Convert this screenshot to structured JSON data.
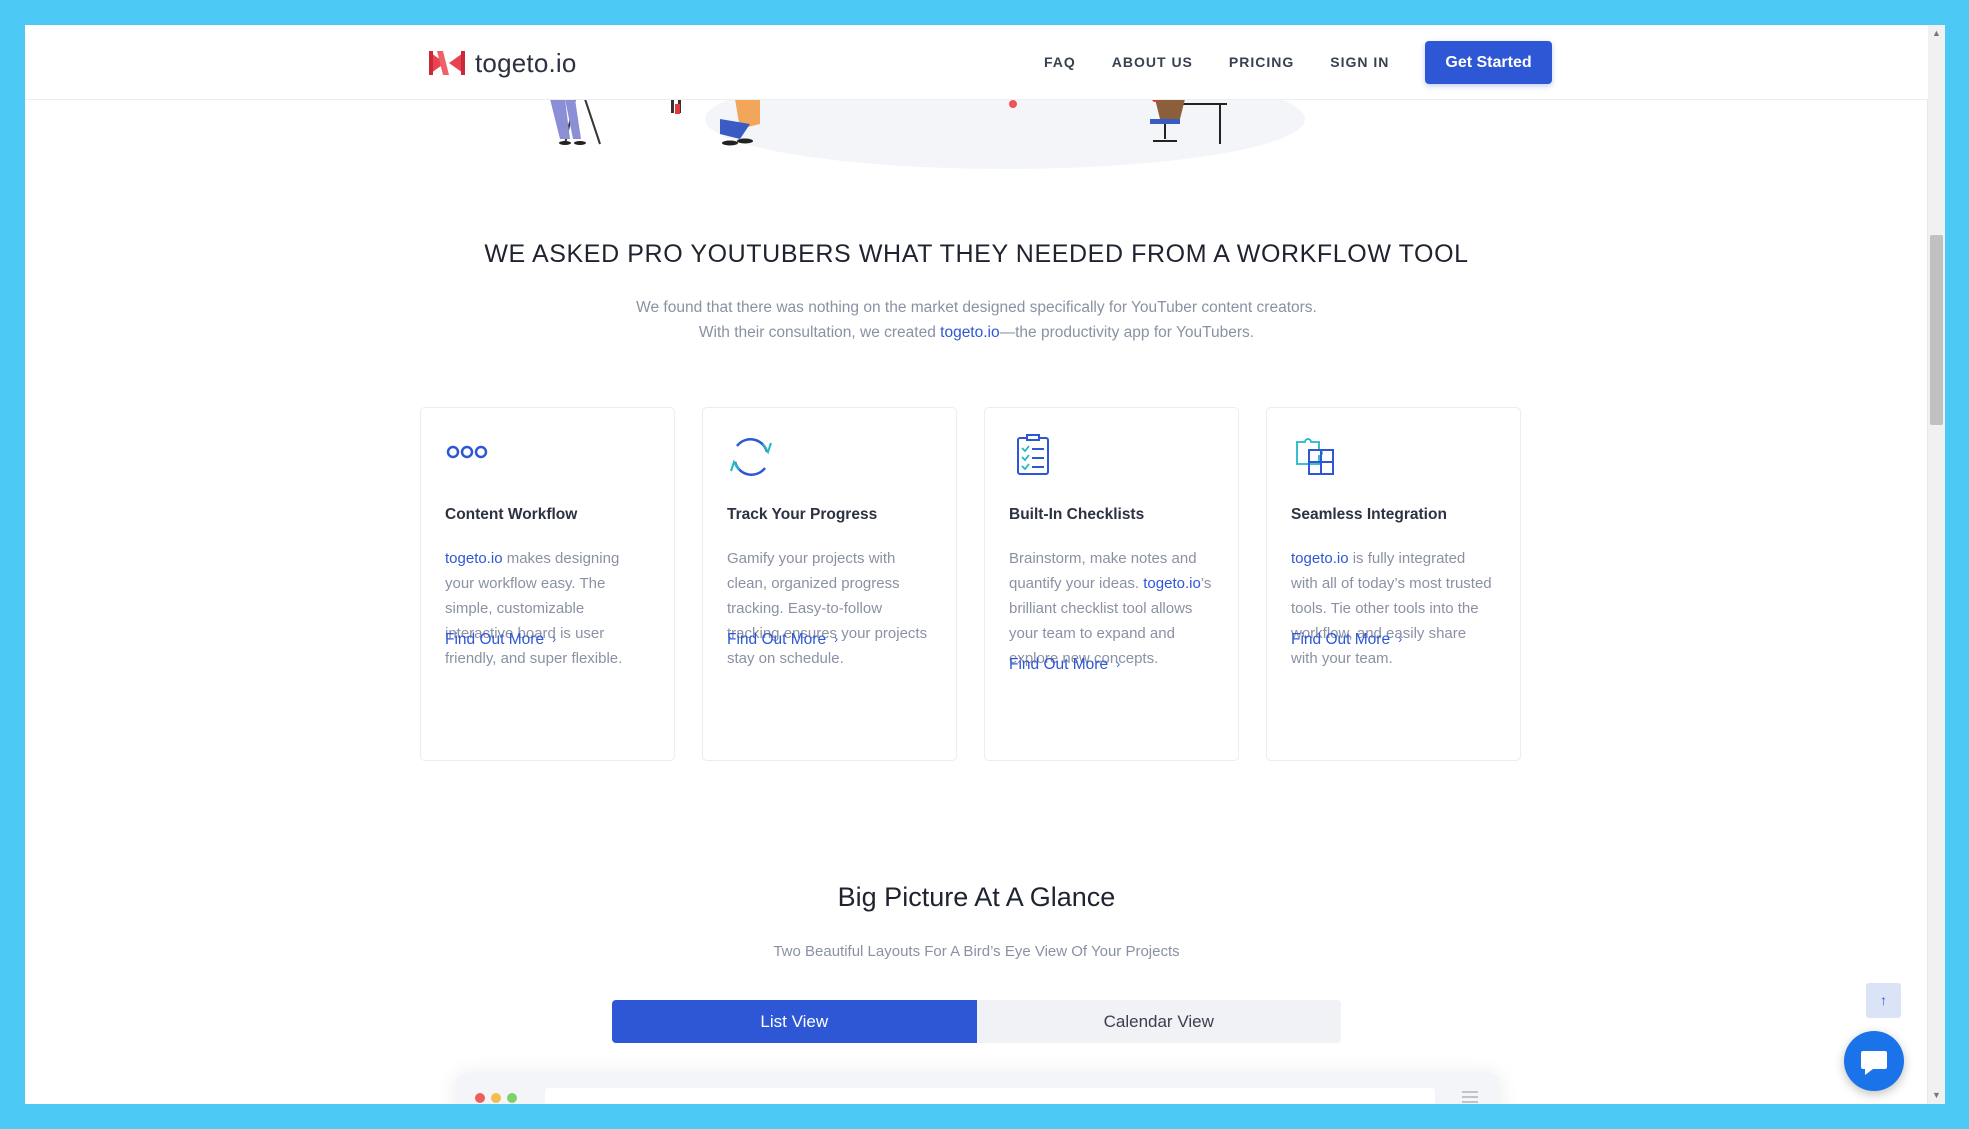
{
  "header": {
    "logo_text": "togeto.io",
    "nav": [
      "FAQ",
      "ABOUT US",
      "PRICING",
      "SIGN IN"
    ],
    "cta": "Get Started"
  },
  "section_features": {
    "title": "WE ASKED PRO YOUTUBERS WHAT THEY NEEDED FROM A WORKFLOW TOOL",
    "intro_line1": "We found that there was nothing on the market designed specifically for YouTuber content creators.",
    "intro_line2_pre": "With their consultation, we created ",
    "intro_line2_brand": "togeto.io",
    "intro_line2_post": "—the productivity app for YouTubers.",
    "cards": [
      {
        "icon": "dots-icon",
        "title": "Content Workflow",
        "brand": "togeto.io",
        "text": " makes designing your workflow easy. The simple, customizable interactive board is user friendly, and super flexible.",
        "link": "Find Out More"
      },
      {
        "icon": "refresh-icon",
        "title": "Track Your Progress",
        "text": "Gamify your projects with clean, organized progress tracking. Easy-to-follow tracking ensures your projects stay on schedule.",
        "link": "Find Out More"
      },
      {
        "icon": "checklist-icon",
        "title": "Built-In Checklists",
        "text_pre": "Brainstorm, make notes and quantify your ideas. ",
        "brand": "togeto.io",
        "text": "’s brilliant checklist tool allows your team to expand and explore new concepts.",
        "link": "Find Out More"
      },
      {
        "icon": "puzzle-icon",
        "title": "Seamless Integration",
        "brand": "togeto.io",
        "text": " is fully integrated with all of today’s most trusted tools. Tie other tools into the workflow, and easily share with your team.",
        "link": "Find Out More"
      }
    ]
  },
  "section_views": {
    "title": "Big Picture At A Glance",
    "subtitle": "Two Beautiful Layouts For A Bird’s Eye View Of Your Projects",
    "tabs": [
      "List View",
      "Calendar View"
    ],
    "active_tab": "List View"
  },
  "colors": {
    "accent": "#2e57d6",
    "muted_text": "#8a91a3",
    "page_bg": "#4cc9f5",
    "chat_button": "#1a73e8"
  },
  "widgets": {
    "back_to_top_icon": "arrow-up-icon",
    "chat_icon": "chat-bubble-icon"
  }
}
